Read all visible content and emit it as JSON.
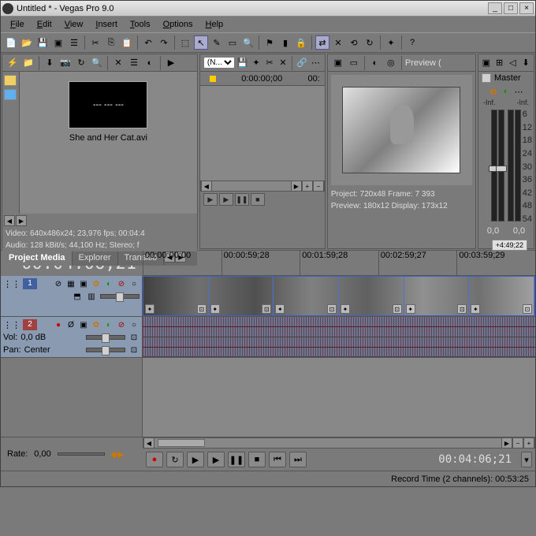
{
  "titlebar": {
    "text": "Untitled * - Vegas Pro 9.0"
  },
  "menu": {
    "file": "File",
    "edit": "Edit",
    "view": "View",
    "insert": "Insert",
    "tools": "Tools",
    "options": "Options",
    "help": "Help"
  },
  "media": {
    "filename": "She and Her Cat.avi",
    "thumb_text": "--- --- ---",
    "video_info": "Video: 640x486x24; 23,976 fps; 00:04:4",
    "audio_info": "Audio: 128 kBit/s; 44,100 Hz; Stereo; f",
    "tabs": {
      "project": "Project Media",
      "explorer": "Explorer",
      "transitions": "Transitio"
    }
  },
  "trimmer": {
    "start": "0:00:00;00",
    "end": "00:"
  },
  "preview": {
    "label": "Preview (",
    "project_line": "Project:  720x48  Frame:   7 393",
    "preview_line": "Preview: 180x12  Display:  173x12"
  },
  "mixer": {
    "master": "Master",
    "inf1": "-Inf.",
    "inf2": "-Inf.",
    "scale": [
      "6",
      "12",
      "18",
      "24",
      "30",
      "36",
      "42",
      "48",
      "54"
    ],
    "val1": "0,0",
    "val2": "0,0"
  },
  "timeline": {
    "timecode": "00:04:06;21",
    "ruler": [
      "00:00:00;00",
      "00:00:59;28",
      "00:01:59;28",
      "00:02:59;27",
      "00:03:59;29"
    ],
    "marker": "+4:49;22",
    "vol_label": "Vol:",
    "vol_val": "0,0 dB",
    "pan_label": "Pan:",
    "pan_val": "Center",
    "track1": "1",
    "track2": "2"
  },
  "rate": {
    "label": "Rate:",
    "value": "0,00"
  },
  "transport": {
    "timecode": "00:04:06;21"
  },
  "status": {
    "text": "Record Time (2 channels): 00:53:25"
  }
}
